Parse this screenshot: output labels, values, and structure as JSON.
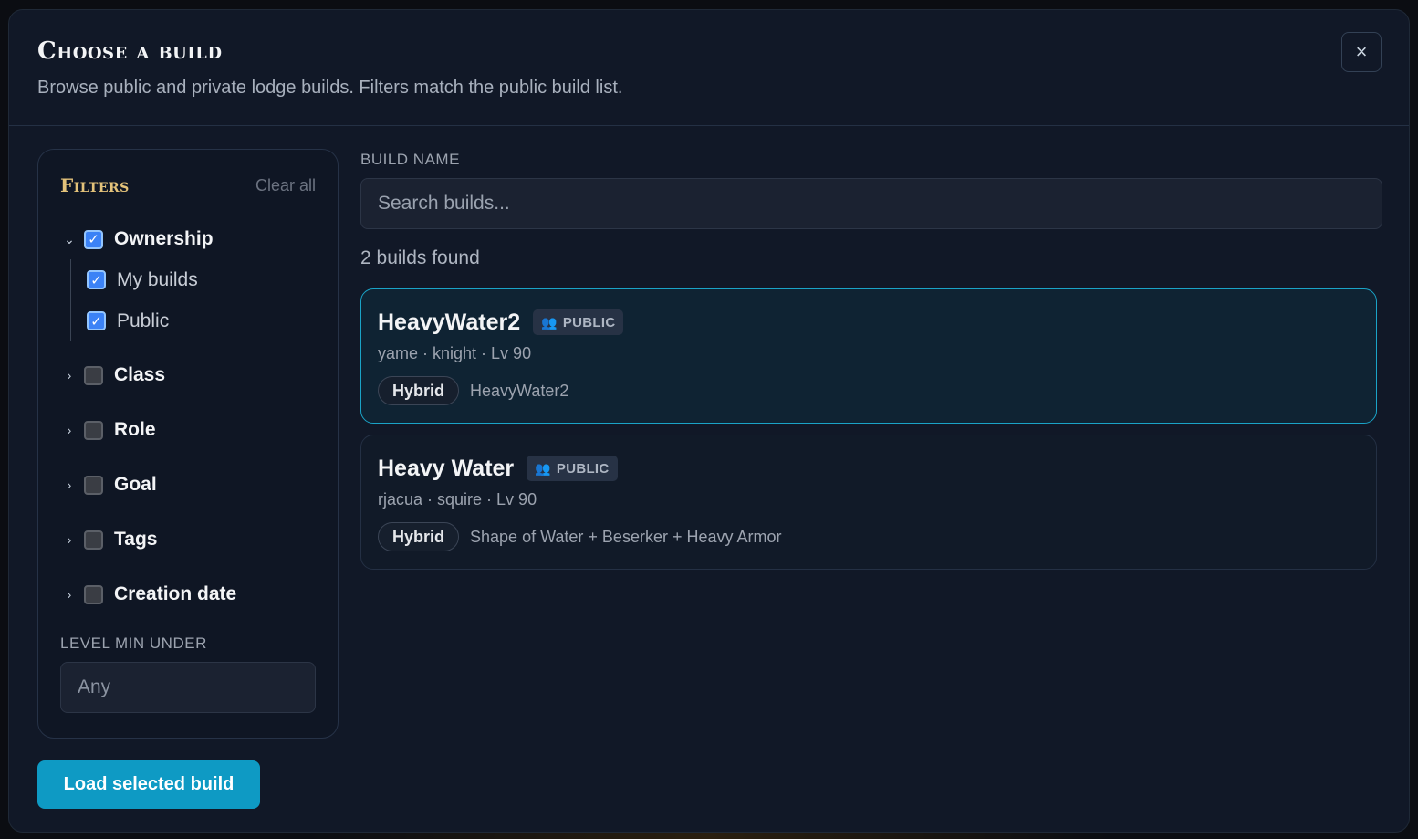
{
  "header": {
    "title": "Choose a build",
    "subtitle": "Browse public and private lodge builds. Filters match the public build list.",
    "close_icon": "×"
  },
  "filters": {
    "title": "Filters",
    "clear_label": "Clear all",
    "groups": [
      {
        "label": "Ownership",
        "expanded": true,
        "checked": true,
        "items": [
          {
            "label": "My builds",
            "checked": true
          },
          {
            "label": "Public",
            "checked": true
          }
        ]
      },
      {
        "label": "Class",
        "expanded": false,
        "checked": false
      },
      {
        "label": "Role",
        "expanded": false,
        "checked": false
      },
      {
        "label": "Goal",
        "expanded": false,
        "checked": false
      },
      {
        "label": "Tags",
        "expanded": false,
        "checked": false
      },
      {
        "label": "Creation date",
        "expanded": false,
        "checked": false
      }
    ],
    "level_label": "LEVEL MIN UNDER",
    "level_placeholder": "Any"
  },
  "search": {
    "label": "BUILD NAME",
    "placeholder": "Search builds..."
  },
  "results": {
    "count_text": "2 builds found",
    "builds": [
      {
        "name": "HeavyWater2",
        "visibility": "PUBLIC",
        "meta": "yame · knight · Lv 90",
        "type": "Hybrid",
        "description": "HeavyWater2",
        "selected": true
      },
      {
        "name": "Heavy Water",
        "visibility": "PUBLIC",
        "meta": "rjacua · squire · Lv 90",
        "type": "Hybrid",
        "description": "Shape of Water + Beserker + Heavy Armor",
        "selected": false
      }
    ]
  },
  "footer": {
    "load_label": "Load selected build"
  },
  "colors": {
    "accent": "#0e9ac4",
    "filters_title": "#e3c27a",
    "selected_border": "#1aa3c7",
    "checkbox": "#3b82f6"
  }
}
